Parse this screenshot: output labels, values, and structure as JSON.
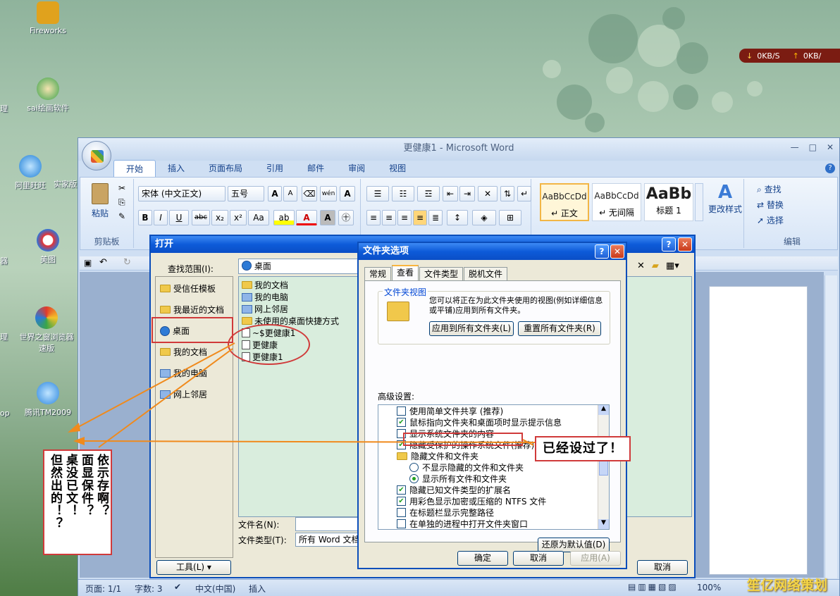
{
  "desktop": {
    "icons": [
      {
        "label": "Fireworks"
      },
      {
        "label": "sai绘画软件"
      },
      {
        "label": "阿里旺旺"
      },
      {
        "label": "实家版"
      },
      {
        "label": "美图"
      },
      {
        "label": "世界之窗浏览器"
      },
      {
        "label": "速版"
      },
      {
        "label": "腾讯TM2009"
      }
    ],
    "edge_labels": [
      "理",
      "器",
      "理",
      "op"
    ],
    "network": {
      "down": "0KB/S",
      "up": "0KB/"
    }
  },
  "word": {
    "title": "更健康1 - Microsoft Word",
    "tabs": [
      "开始",
      "插入",
      "页面布局",
      "引用",
      "邮件",
      "审阅",
      "视图"
    ],
    "clipboard": {
      "paste": "粘贴",
      "group": "剪贴板"
    },
    "font": {
      "name": "宋体 (中文正文)",
      "size": "五号",
      "bold": "B",
      "italic": "I",
      "underline": "U",
      "strike": "abc",
      "sub": "x₂",
      "sup": "x²",
      "case": "Aa",
      "grow": "A",
      "shrink": "A",
      "color_a": "A",
      "box_a": "A",
      "pinyin": "wén"
    },
    "styles": [
      {
        "sample": "AaBbCcDd",
        "name": "↵ 正文"
      },
      {
        "sample": "AaBbCcDd",
        "name": "↵ 无间隔"
      },
      {
        "sample": "AaBb",
        "name": "标题 1"
      }
    ],
    "change_styles": "更改样式",
    "edit": {
      "find": "查找",
      "replace": "替换",
      "select": "选择",
      "group": "编辑"
    },
    "status": {
      "page": "页面: 1/1",
      "words": "字数: 3",
      "lang": "中文(中国)",
      "mode": "插入",
      "zoom": "100%"
    }
  },
  "open_dialog": {
    "title": "打开",
    "look_in_label": "查找范围(I):",
    "look_in_value": "桌面",
    "places": [
      "受信任模板",
      "我最近的文档",
      "桌面",
      "我的文档",
      "我的电脑",
      "网上邻居"
    ],
    "files": [
      "我的文档",
      "我的电脑",
      "网上邻居",
      "未使用的桌面快捷方式",
      "~$更健康1",
      "更健康",
      "更健康1"
    ],
    "file_name_label": "文件名(N):",
    "file_type_label": "文件类型(T):",
    "file_type_value": "所有 Word 文档",
    "tools": "工具(L)",
    "cancel": "取消"
  },
  "folder_options": {
    "title": "文件夹选项",
    "tabs": [
      "常规",
      "查看",
      "文件类型",
      "脱机文件"
    ],
    "folder_view_legend": "文件夹视图",
    "folder_view_text": "您可以将正在为此文件夹使用的视图(例如详细信息或平铺)应用到所有文件夹。",
    "apply_all": "应用到所有文件夹(L)",
    "reset_all": "重置所有文件夹(R)",
    "advanced_label": "高级设置:",
    "options": [
      {
        "type": "checkbox",
        "checked": false,
        "label": "使用简单文件共享 (推荐)"
      },
      {
        "type": "checkbox",
        "checked": true,
        "label": "鼠标指向文件夹和桌面项时显示提示信息"
      },
      {
        "type": "checkbox",
        "checked": false,
        "label": "显示系统文件夹的内容"
      },
      {
        "type": "checkbox",
        "checked": true,
        "label": "隐藏受保护的操作系统文件(推荐)"
      },
      {
        "type": "folder",
        "label": "隐藏文件和文件夹"
      },
      {
        "type": "radio",
        "checked": false,
        "label": "不显示隐藏的文件和文件夹"
      },
      {
        "type": "radio",
        "checked": true,
        "label": "显示所有文件和文件夹"
      },
      {
        "type": "checkbox",
        "checked": true,
        "label": "隐藏已知文件类型的扩展名"
      },
      {
        "type": "checkbox",
        "checked": true,
        "label": "用彩色显示加密或压缩的 NTFS 文件"
      },
      {
        "type": "checkbox",
        "checked": false,
        "label": "在标题栏显示完整路径"
      },
      {
        "type": "checkbox",
        "checked": false,
        "label": "在单独的进程中打开文件夹窗口"
      }
    ],
    "restore_defaults": "还原为默认值(D)",
    "ok": "确定",
    "cancel": "取消",
    "apply": "应用(A)"
  },
  "annotations": {
    "right_note": "已经设过了！",
    "left_note_columns": [
      "但然出的！？",
      "桌没已文！",
      "面显保件？",
      "依示存啊？"
    ]
  },
  "watermark": "笙亿网络策划"
}
